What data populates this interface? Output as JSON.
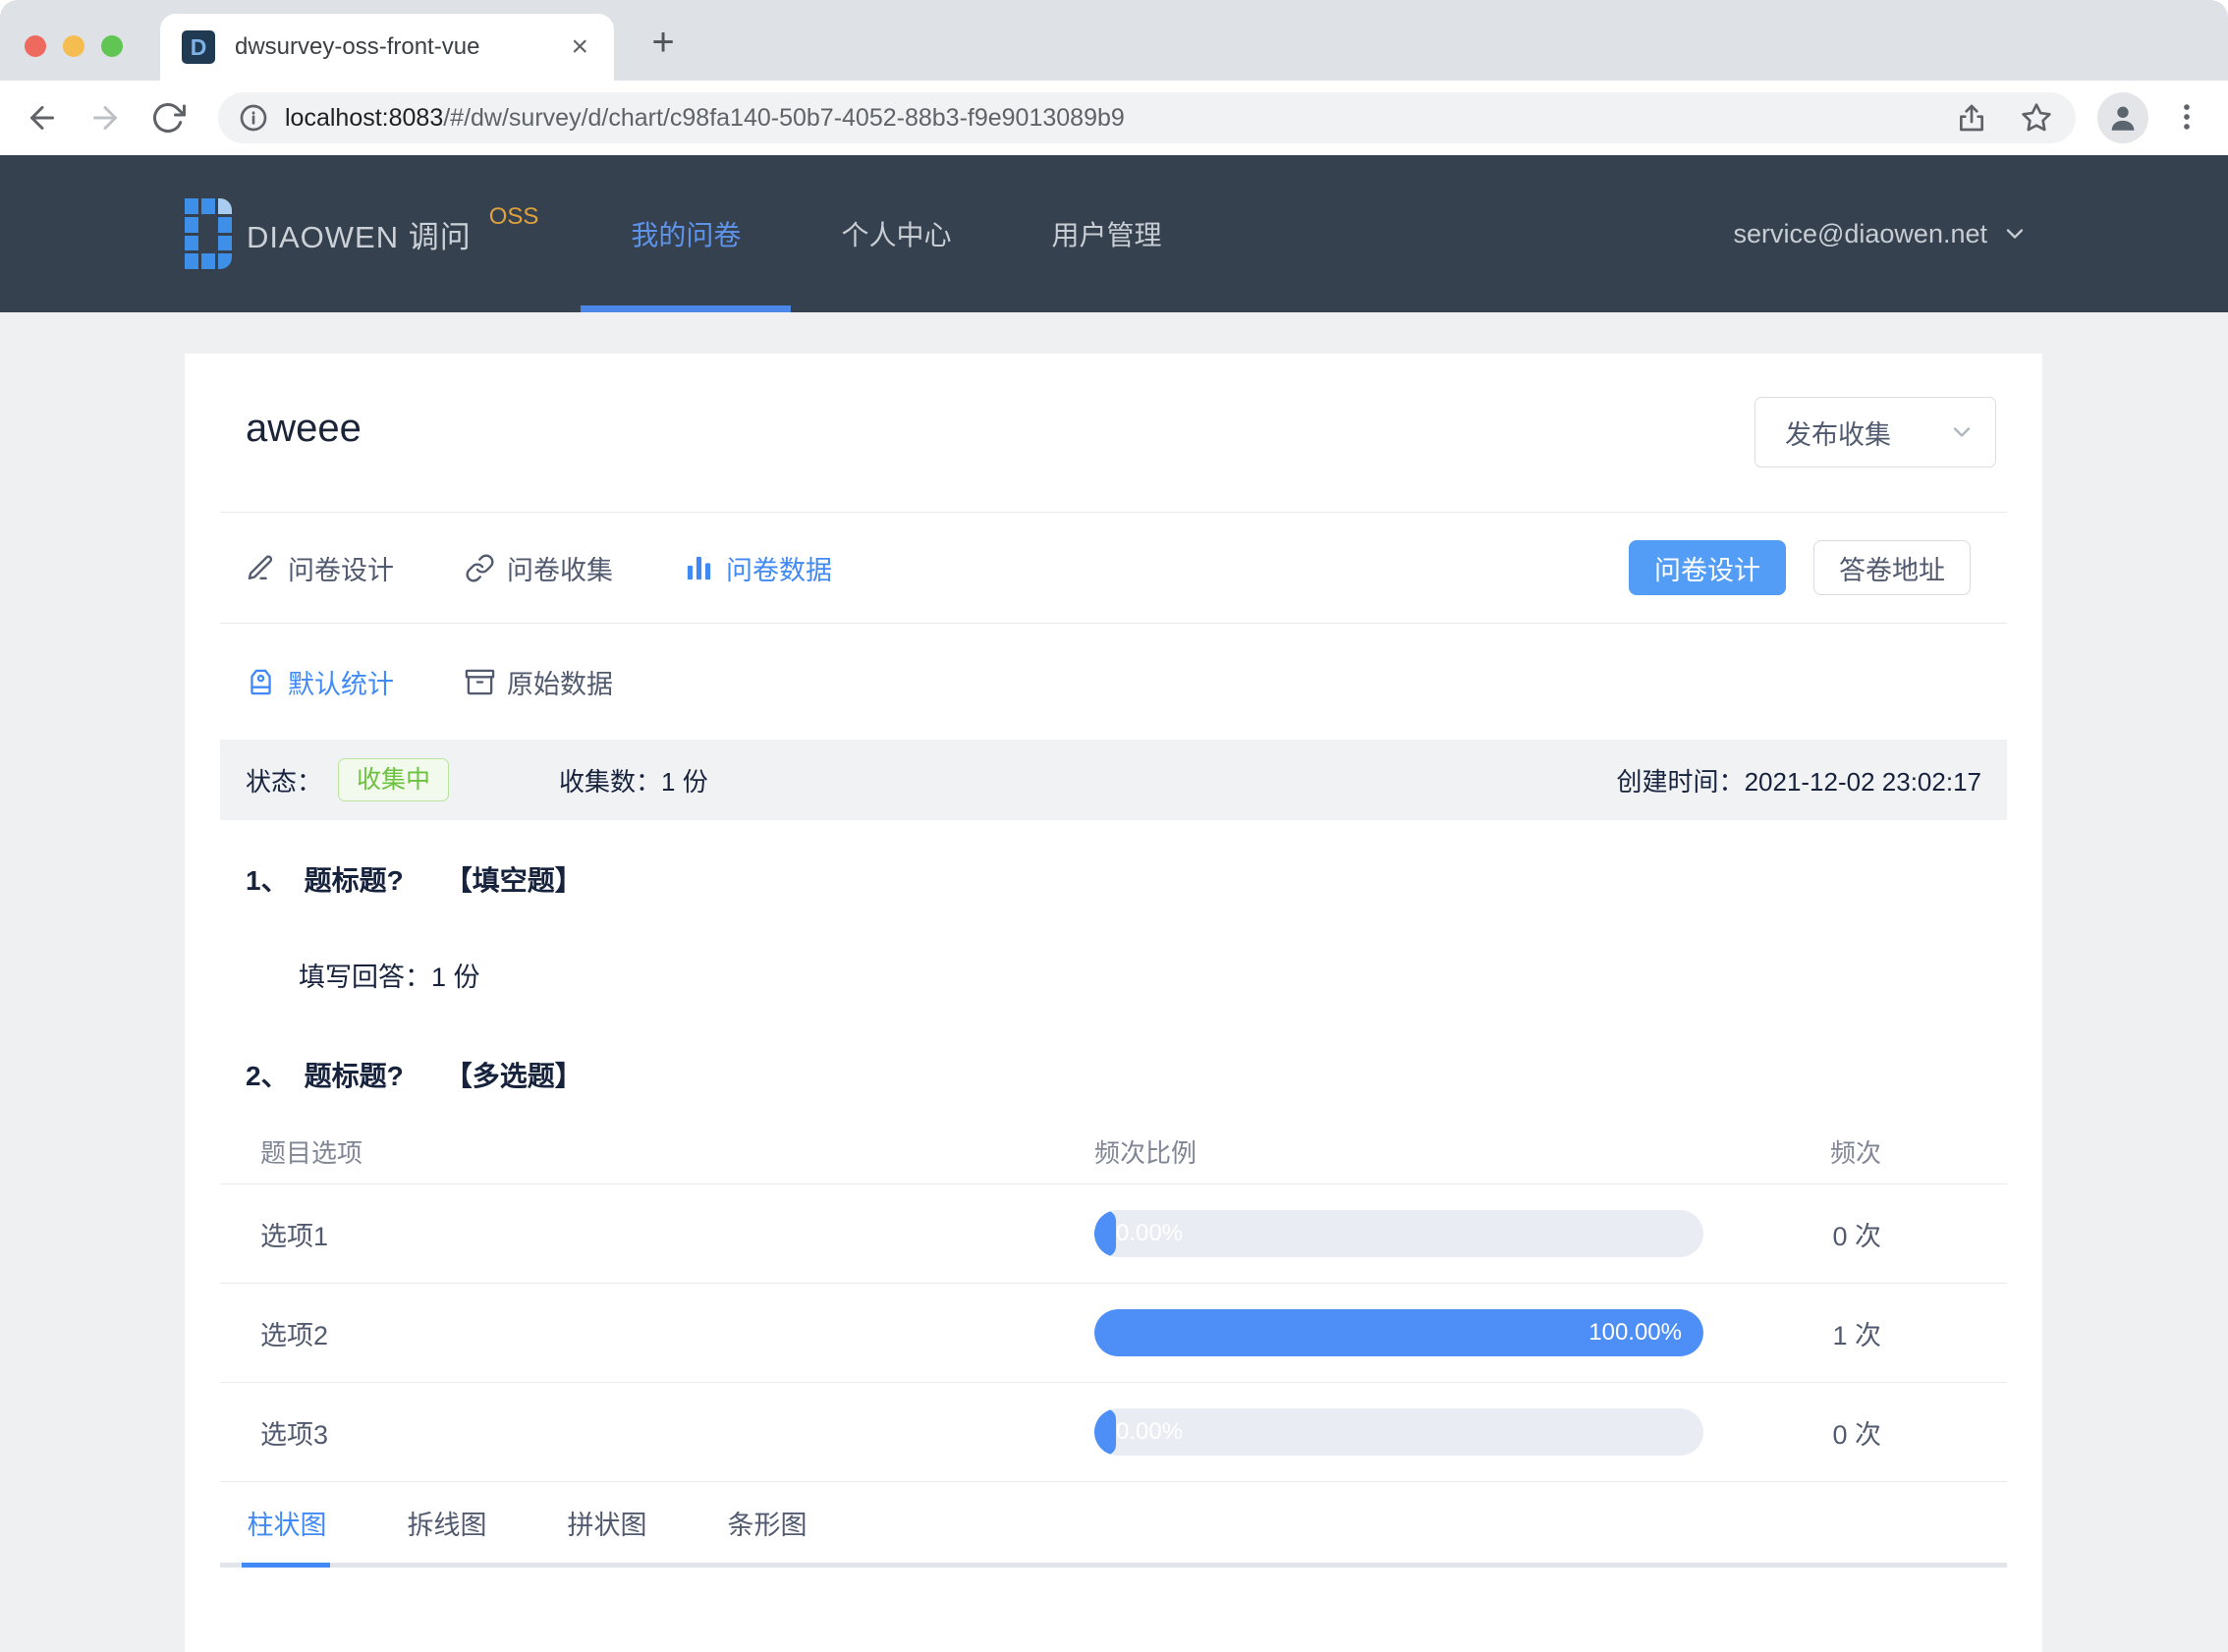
{
  "browser": {
    "tab_title": "dwsurvey-oss-front-vue",
    "favicon_letter": "D",
    "url_host": "localhost:8083",
    "url_path": "/#/dw/survey/d/chart/c98fa140-50b7-4052-88b3-f9e9013089b9"
  },
  "header": {
    "brand": "DIAOWEN 调问",
    "brand_badge": "OSS",
    "nav": [
      "我的问卷",
      "个人中心",
      "用户管理"
    ],
    "user_email": "service@diaowen.net"
  },
  "survey": {
    "title": "aweee",
    "publish_dropdown": "发布收集",
    "tabs": [
      "问卷设计",
      "问卷收集",
      "问卷数据"
    ],
    "design_button": "问卷设计",
    "answer_button": "答卷地址",
    "stat_tabs": [
      "默认统计",
      "原始数据"
    ],
    "status_label": "状态：",
    "status_value": "收集中",
    "count_label": "收集数：",
    "count_value": "1 份",
    "created_label": "创建时间：",
    "created_value": "2021-12-02 23:02:17"
  },
  "questions": [
    {
      "number": "1、",
      "title": "题标题?",
      "type": "【填空题】",
      "answer_label": "填写回答：",
      "answer_value": "1 份"
    },
    {
      "number": "2、",
      "title": "题标题?",
      "type": "【多选题】"
    }
  ],
  "table": {
    "headers": [
      "题目选项",
      "频次比例",
      "频次"
    ],
    "rows": [
      {
        "option": "选项1",
        "percent": "0.00%",
        "value": 0,
        "count": "0 次"
      },
      {
        "option": "选项2",
        "percent": "100.00%",
        "value": 100,
        "count": "1 次"
      },
      {
        "option": "选项3",
        "percent": "0.00%",
        "value": 0,
        "count": "0 次"
      }
    ]
  },
  "chart_tabs": [
    "柱状图",
    "拆线图",
    "拼状图",
    "条形图"
  ],
  "colors": {
    "accent_blue": "#418af5",
    "bar_blue": "#4d8ff7",
    "header_navy": "#364150",
    "status_green": "#6cc13f",
    "badge_green_bg": "#f2faee"
  }
}
